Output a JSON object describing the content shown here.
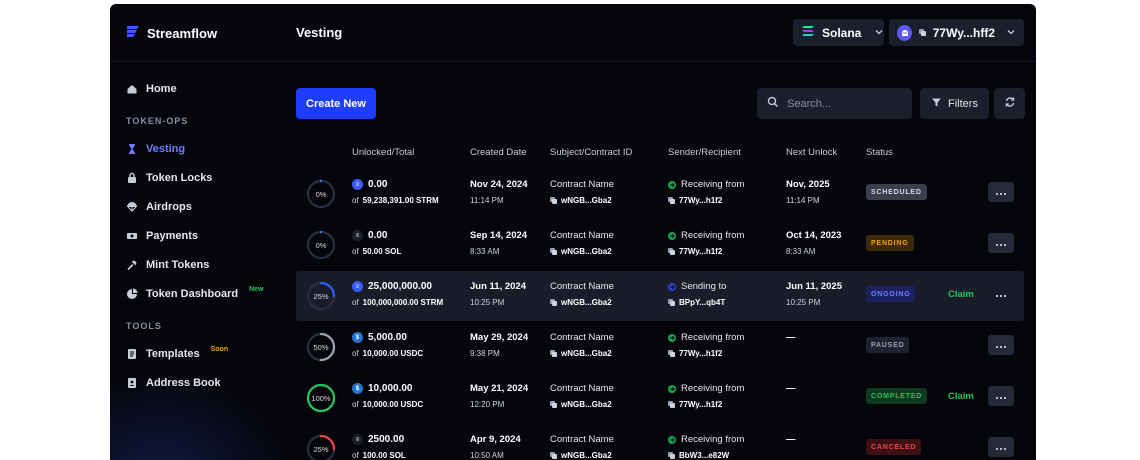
{
  "app": {
    "name": "Streamflow",
    "page_title": "Vesting"
  },
  "topbar": {
    "network": {
      "label": "Solana",
      "icon": "solana-logo-icon"
    },
    "wallet": {
      "label": "77Wy...hff2",
      "icon": "wallet-avatar-icon"
    }
  },
  "sidebar": {
    "home": "Home",
    "section_tokenops": "TOKEN-OPS",
    "items": [
      {
        "label": "Vesting",
        "icon": "hourglass-icon",
        "active": true
      },
      {
        "label": "Token Locks",
        "icon": "lock-icon"
      },
      {
        "label": "Airdrops",
        "icon": "parachute-icon"
      },
      {
        "label": "Payments",
        "icon": "money-icon"
      },
      {
        "label": "Mint Tokens",
        "icon": "hammer-icon"
      },
      {
        "label": "Token Dashboard",
        "icon": "pie-chart-icon",
        "badge": "New"
      }
    ],
    "section_tools": "TOOLS",
    "tools": [
      {
        "label": "Templates",
        "icon": "document-icon",
        "badge": "Soon"
      },
      {
        "label": "Address Book",
        "icon": "address-book-icon"
      }
    ]
  },
  "toolbar": {
    "create_label": "Create New",
    "search_placeholder": "Search...",
    "filters_label": "Filters"
  },
  "table": {
    "headers": {
      "unlocked": "Unlocked/Total",
      "created": "Created Date",
      "subject": "Subject/Contract ID",
      "sender": "Sender/Recipient",
      "next_unlock": "Next Unlock",
      "status": "Status"
    },
    "rows": [
      {
        "percent": "0%",
        "progress": 0,
        "ring_color": "#3b82f6",
        "amount": "0.00",
        "total": "59,238,391.00 STRM",
        "token_icon": "strm-token-icon",
        "token_color": "#3b5bfd",
        "created_date": "Nov 24, 2024",
        "created_time": "11:14 PM",
        "contract_name": "Contract Name",
        "contract_id": "wNGB...Gba2",
        "direction": "Receiving from",
        "dir_icon": "incoming-arrow-icon",
        "dir_color": "#16a34a",
        "address": "77Wy...h1f2",
        "next_date": "Nov, 2025",
        "next_time": "11:14 PM",
        "status": "SCHEDULED",
        "status_fg": "#d6d9e2",
        "status_bg": "#3a3e4d",
        "claim": ""
      },
      {
        "percent": "0%",
        "progress": 0,
        "ring_color": "#3b82f6",
        "amount": "0.00",
        "total": "50.00 SOL",
        "token_icon": "sol-token-icon",
        "token_color": "#1c1f2b",
        "created_date": "Sep 14, 2024",
        "created_time": "8:33 AM",
        "contract_name": "Contract Name",
        "contract_id": "wNGB...Gba2",
        "direction": "Receiving from",
        "dir_icon": "incoming-arrow-icon",
        "dir_color": "#16a34a",
        "address": "77Wy...h1f2",
        "next_date": "Oct 14, 2023",
        "next_time": "8:33 AM",
        "status": "PENDING",
        "status_fg": "#f59e0b",
        "status_bg": "#3d2a0c",
        "claim": ""
      },
      {
        "percent": "25%",
        "progress": 0.25,
        "ring_color": "#2563eb",
        "amount": "25,000,000.00",
        "total": "100,000,000.00 STRM",
        "token_icon": "strm-token-icon",
        "token_color": "#3b5bfd",
        "created_date": "Jun 11, 2024",
        "created_time": "10:25 PM",
        "contract_name": "Contract Name",
        "contract_id": "wNGB...Gba2",
        "direction": "Sending to",
        "dir_icon": "outgoing-arrow-icon",
        "dir_color": "#2f3fc8",
        "address": "BPpY...qb4T",
        "next_date": "Jun 11, 2025",
        "next_time": "10:25 PM",
        "status": "ONGOING",
        "status_fg": "#6f7dfd",
        "status_bg": "#1a2360",
        "claim": "Claim"
      },
      {
        "percent": "50%",
        "progress": 0.5,
        "ring_color": "#9ca3af",
        "amount": "5,000.00",
        "total": "10,000.00 USDC",
        "token_icon": "usdc-token-icon",
        "token_color": "#2775ca",
        "created_date": "May 29, 2024",
        "created_time": "9:38 PM",
        "contract_name": "Contract Name",
        "contract_id": "wNGB...Gba2",
        "direction": "Receiving from",
        "dir_icon": "incoming-arrow-icon",
        "dir_color": "#16a34a",
        "address": "77Wy...h1f2",
        "next_date": "—",
        "next_time": "",
        "status": "PAUSED",
        "status_fg": "#9ca3af",
        "status_bg": "#1f2230",
        "claim": ""
      },
      {
        "percent": "100%",
        "progress": 1,
        "ring_color": "#22c55e",
        "amount": "10,000.00",
        "total": "10,000.00 USDC",
        "token_icon": "usdc-token-icon",
        "token_color": "#2775ca",
        "created_date": "May 21, 2024",
        "created_time": "12:20 PM",
        "contract_name": "Contract Name",
        "contract_id": "wNGB...Gba2",
        "direction": "Receiving from",
        "dir_icon": "incoming-arrow-icon",
        "dir_color": "#16a34a",
        "address": "77Wy...h1f2",
        "next_date": "—",
        "next_time": "",
        "status": "COMPLETED",
        "status_fg": "#22c55e",
        "status_bg": "#0f3a1f",
        "claim": "Claim"
      },
      {
        "percent": "25%",
        "progress": 0.25,
        "ring_color": "#ef4444",
        "amount": "2500.00",
        "total": "100.00 SOL",
        "token_icon": "sol-token-icon",
        "token_color": "#1c1f2b",
        "created_date": "Apr 9, 2024",
        "created_time": "10:50 AM",
        "contract_name": "Contract Name",
        "contract_id": "wNGB...Gba2",
        "direction": "Receiving from",
        "dir_icon": "incoming-arrow-icon",
        "dir_color": "#16a34a",
        "address": "BbW3...e82W",
        "next_date": "—",
        "next_time": "",
        "status": "CANCELED",
        "status_fg": "#ef4444",
        "status_bg": "#3d1114",
        "claim": ""
      }
    ]
  },
  "colors": {
    "accent": "#1f3dff",
    "active_nav": "#6f7dfd",
    "background": "#05060c",
    "panel": "#1b1e2b"
  }
}
